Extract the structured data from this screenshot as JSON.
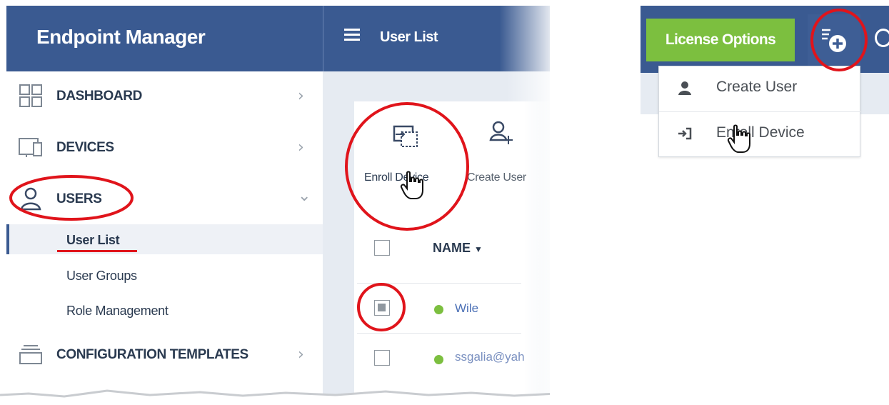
{
  "app": {
    "title": "Endpoint Manager"
  },
  "topbar": {
    "page_title": "User List",
    "license_button": "License Options"
  },
  "sidebar": {
    "items": [
      {
        "label": "DASHBOARD",
        "icon": "dashboard-grid-icon",
        "chevron": "chevron-right-icon"
      },
      {
        "label": "DEVICES",
        "icon": "devices-icon",
        "chevron": "chevron-right-icon"
      },
      {
        "label": "USERS",
        "icon": "user-icon",
        "chevron": "chevron-down-icon",
        "expanded": true
      },
      {
        "label": "CONFIGURATION TEMPLATES",
        "icon": "templates-icon",
        "chevron": "chevron-right-icon"
      }
    ],
    "users_subitems": [
      {
        "label": "User List",
        "active": true
      },
      {
        "label": "User Groups"
      },
      {
        "label": "Role Management"
      }
    ]
  },
  "toolbar": {
    "enroll_device": "Enroll Device",
    "create_user": "Create User"
  },
  "table": {
    "column_name": "NAME",
    "rows": [
      {
        "name": "Wile",
        "checked": true,
        "status_color": "#7cbf3f"
      },
      {
        "name": "ssgalia@yah",
        "checked": false,
        "status_color": "#7cbf3f"
      }
    ]
  },
  "add_menu": {
    "items": [
      {
        "label": "Create User",
        "icon": "user-solid-icon"
      },
      {
        "label": "Enroll Device",
        "icon": "sign-in-icon"
      }
    ]
  },
  "colors": {
    "header": "#3a5a91",
    "license_green": "#7cbf3f",
    "annotation_red": "#e0141b",
    "link_blue": "#4a6fb5"
  }
}
